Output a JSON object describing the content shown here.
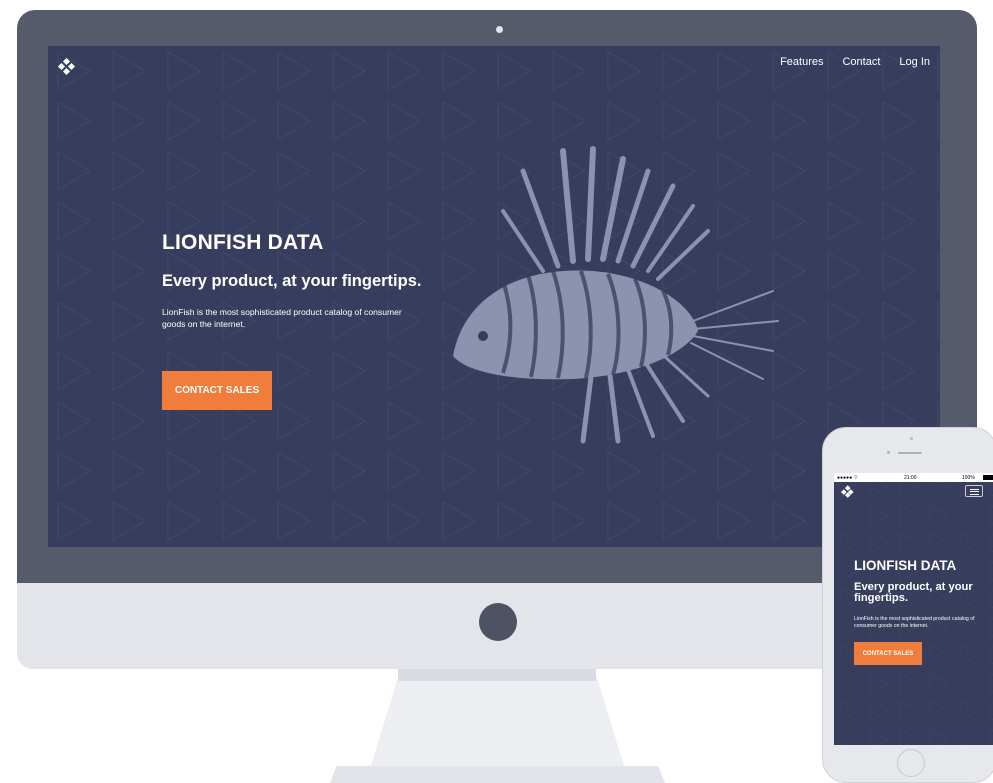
{
  "nav": {
    "items": [
      {
        "label": "Features"
      },
      {
        "label": "Contact"
      },
      {
        "label": "Log In"
      }
    ]
  },
  "hero": {
    "title": "LIONFISH DATA",
    "subtitle": "Every product, at your fingertips.",
    "description": "LionFish is the most sophisticated product catalog of consumer goods on the internet.",
    "cta_label": "CONTACT SALES"
  },
  "mobile": {
    "status": {
      "signal": "●●●●● ⌔",
      "time": "21:00",
      "battery": "100%"
    },
    "title": "LIONFISH DATA",
    "subtitle": "Every product, at your fingertips.",
    "description": "LionFish is the most sophisticated product catalog of consumer goods on the internet.",
    "cta_label": "CONTACT SALES"
  },
  "icons": {
    "logo": "diamond-logo-icon",
    "hero_image": "lionfish-illustration",
    "menu": "hamburger-menu-icon"
  },
  "colors": {
    "screen_bg": "#363d5d",
    "accent": "#f07d3b",
    "monitor_frame": "#555b6b",
    "monitor_chin": "#e3e5ea",
    "fish": "#8c93ae"
  }
}
